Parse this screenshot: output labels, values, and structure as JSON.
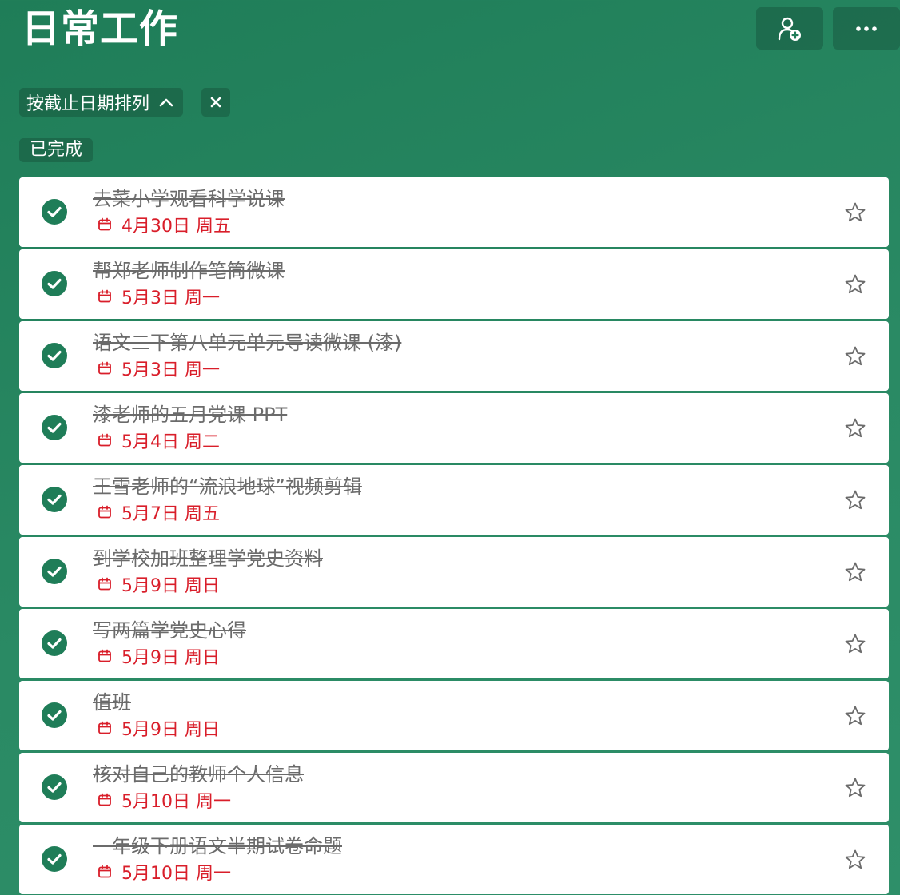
{
  "header": {
    "title": "日常工作",
    "share_icon": "person-add-icon",
    "more_icon": "more-horizontal-icon"
  },
  "sort": {
    "label": "按截止日期排列",
    "direction_icon": "chevron-up-icon",
    "clear_icon": "close-icon"
  },
  "section": {
    "label": "已完成"
  },
  "colors": {
    "accent": "#1f7d58",
    "due_red": "#d91e2a",
    "completed_text": "#6b6b6b"
  },
  "tasks": [
    {
      "title": "去菜小学观看科学说课",
      "due": "4月30日 周五"
    },
    {
      "title": "帮郑老师制作笔筒微课",
      "due": "5月3日 周一"
    },
    {
      "title": "语文二下第八单元单元导读微课 (漆)",
      "due": "5月3日 周一"
    },
    {
      "title": "漆老师的五月党课 PPT",
      "due": "5月4日 周二"
    },
    {
      "title": "王雪老师的“流浪地球”视频剪辑",
      "due": "5月7日 周五"
    },
    {
      "title": "到学校加班整理学党史资料",
      "due": "5月9日 周日"
    },
    {
      "title": "写两篇学党史心得",
      "due": "5月9日 周日"
    },
    {
      "title": "值班",
      "due": "5月9日 周日"
    },
    {
      "title": "核对自己的教师个人信息",
      "due": "5月10日 周一"
    },
    {
      "title": "一年级下册语文半期试卷命题",
      "due": "5月10日 周一"
    }
  ]
}
